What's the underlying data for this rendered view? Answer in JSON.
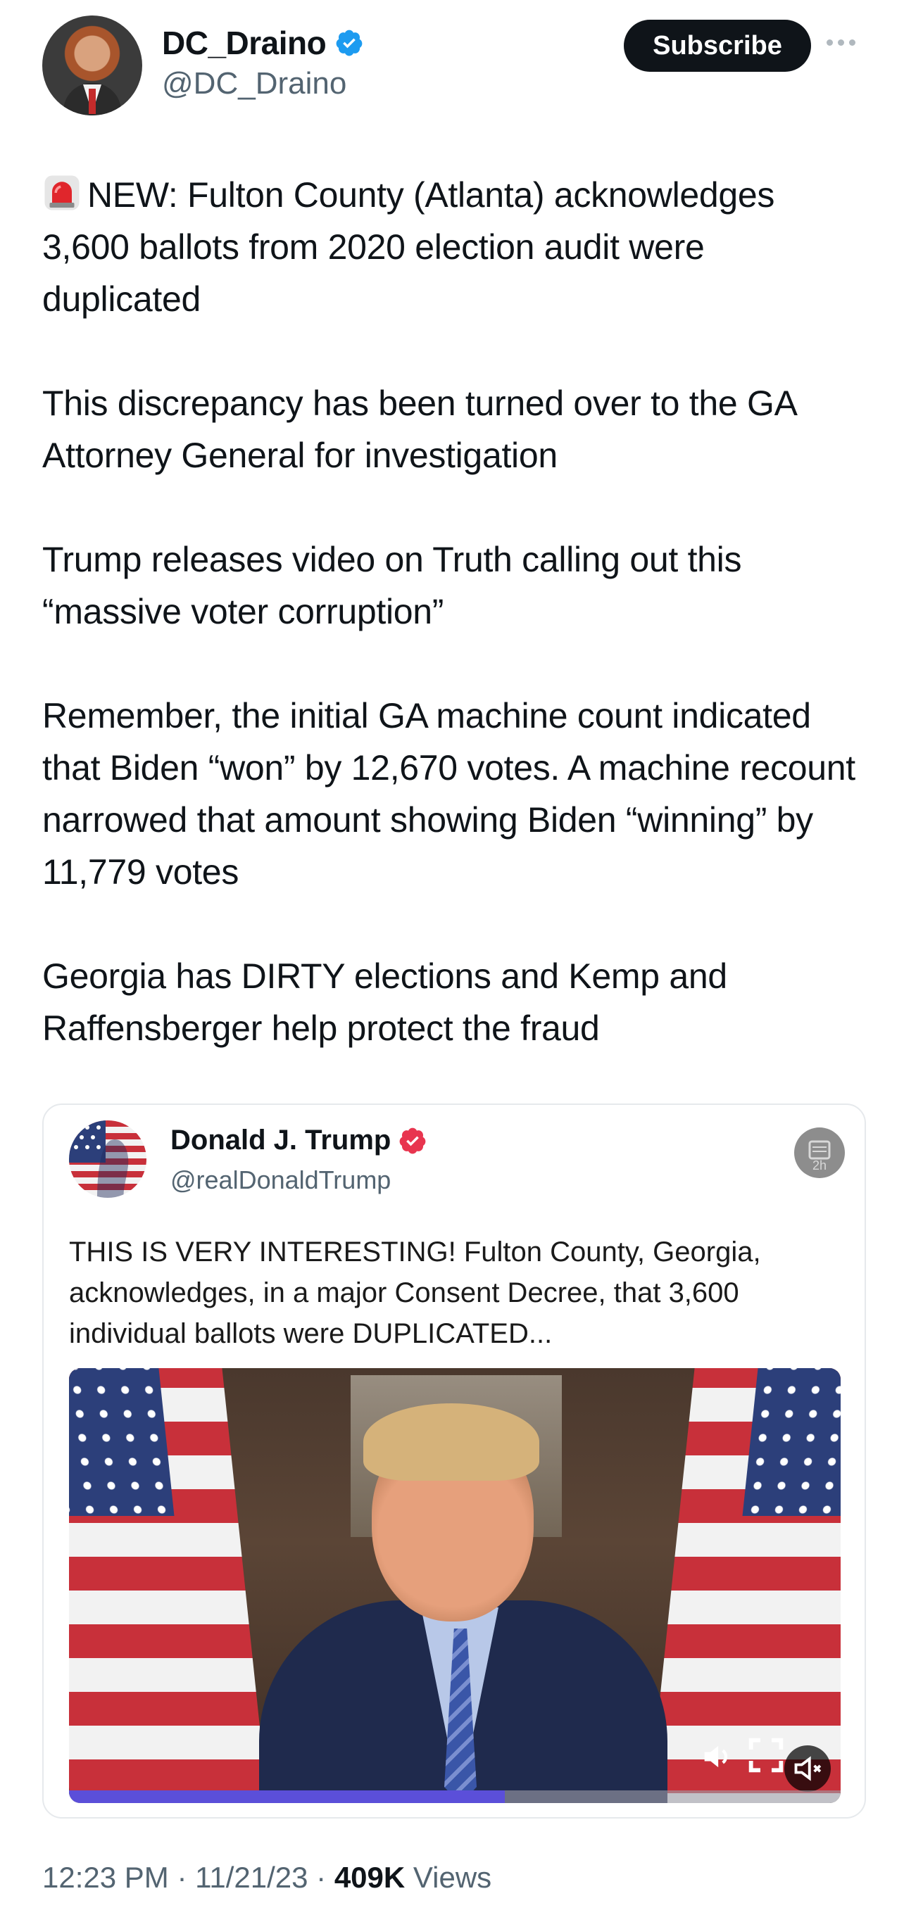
{
  "author": {
    "display_name": "DC_Draino",
    "handle": "@DC_Draino",
    "verified_color": "#1d9bf0",
    "avatar_icon": "profile-photo"
  },
  "actions": {
    "subscribe_label": "Subscribe",
    "more_icon": "more-dots-icon"
  },
  "tweet": {
    "paragraphs": [
      "NEW: Fulton County (Atlanta) acknowledges 3,600 ballots from 2020 election audit were duplicated",
      "This discrepancy has been turned over to the GA Attorney General for investigation",
      "Trump releases video on Truth calling out this “massive voter corruption”",
      "Remember, the initial GA machine count indicated that Biden “won” by 12,670 votes. A machine recount narrowed that amount showing Biden “winning” by 11,779 votes",
      "Georgia has DIRTY elections and Kemp and Raffensberger help protect the fraud"
    ],
    "lead_icon": "siren-emoji"
  },
  "quote": {
    "display_name": "Donald J. Trump",
    "handle": "@realDonaldTrump",
    "badge_color": "#e8354f",
    "time_label": "2h",
    "text": "THIS IS VERY INTERESTING! Fulton County, Georgia, acknowledges, in a major Consent Decree, that 3,600 individual ballots were DUPLICATED...",
    "video": {
      "progress": 0.565,
      "progress_color": "#5b4fd9"
    }
  },
  "meta": {
    "time": "12:23 PM",
    "date": "11/21/23",
    "views_count": "409K",
    "views_label": "Views",
    "separator": " · "
  }
}
